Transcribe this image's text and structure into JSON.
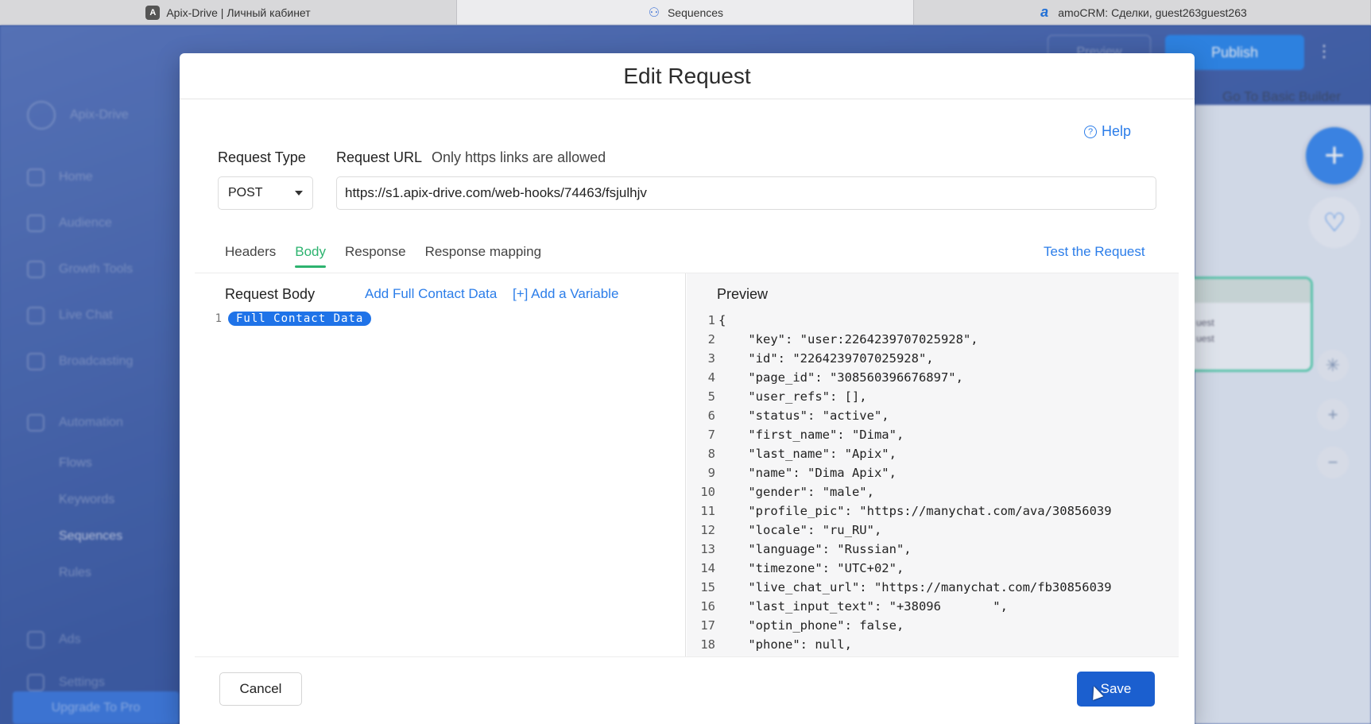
{
  "browser_tabs": [
    {
      "label": "Apix-Drive | Личный кабинет",
      "icon": "apix-icon"
    },
    {
      "label": "Sequences",
      "icon": "sequences-icon"
    },
    {
      "label": "amoCRM: Сделки, guest263guest263",
      "icon": "amocrm-icon"
    }
  ],
  "background": {
    "publish_label": "Publish",
    "preview_label": "Preview",
    "basic_builder": "Go To Basic Builder",
    "sidebar": {
      "items": [
        "Apix-Drive",
        "Home",
        "Audience",
        "Growth Tools",
        "Live Chat",
        "Broadcasting",
        "Automation",
        "Ads",
        "Settings"
      ],
      "sub_items": [
        "Flows",
        "Keywords",
        "Sequences",
        "Rules"
      ],
      "upgrade": "Upgrade To Pro"
    },
    "node_lines": [
      "uest",
      "uest"
    ]
  },
  "modal": {
    "title": "Edit Request",
    "help_label": "Help",
    "request_type_label": "Request Type",
    "request_type_value": "POST",
    "request_url_label": "Request URL",
    "request_url_hint": "Only https links are allowed",
    "request_url_value": "https://s1.apix-drive.com/web-hooks/74463/fsjulhjv",
    "tabs": [
      "Headers",
      "Body",
      "Response",
      "Response mapping"
    ],
    "active_tab": "Body",
    "test_label": "Test the Request",
    "body": {
      "title": "Request Body",
      "add_full_contact": "Add Full Contact Data",
      "add_variable": "[+] Add a Variable",
      "line_number": "1",
      "chip_text": "Full Contact Data"
    },
    "preview": {
      "title": "Preview",
      "lines": [
        {
          "n": "1",
          "text": "{"
        },
        {
          "n": "2",
          "text": "    \"key\": \"user:2264239707025928\","
        },
        {
          "n": "3",
          "text": "    \"id\": \"2264239707025928\","
        },
        {
          "n": "4",
          "text": "    \"page_id\": \"308560396676897\","
        },
        {
          "n": "5",
          "text": "    \"user_refs\": [],"
        },
        {
          "n": "6",
          "text": "    \"status\": \"active\","
        },
        {
          "n": "7",
          "text": "    \"first_name\": \"Dima\","
        },
        {
          "n": "8",
          "text": "    \"last_name\": \"Apix\","
        },
        {
          "n": "9",
          "text": "    \"name\": \"Dima Apix\","
        },
        {
          "n": "10",
          "text": "    \"gender\": \"male\","
        },
        {
          "n": "11",
          "text": "    \"profile_pic\": \"https://manychat.com/ava/30856039"
        },
        {
          "n": "12",
          "text": "    \"locale\": \"ru_RU\","
        },
        {
          "n": "13",
          "text": "    \"language\": \"Russian\","
        },
        {
          "n": "14",
          "text": "    \"timezone\": \"UTC+02\","
        },
        {
          "n": "15",
          "text": "    \"live_chat_url\": \"https://manychat.com/fb30856039"
        },
        {
          "n": "16",
          "text": "    \"last_input_text\": \"+38096       \","
        },
        {
          "n": "17",
          "text": "    \"optin_phone\": false,"
        },
        {
          "n": "18",
          "text": "    \"phone\": null,"
        }
      ]
    },
    "cancel_label": "Cancel",
    "save_label": "Save"
  },
  "colors": {
    "accent": "#2b7de9",
    "active_tab": "#2db36f",
    "save": "#1b5fcf",
    "chip": "#1f73e8"
  }
}
